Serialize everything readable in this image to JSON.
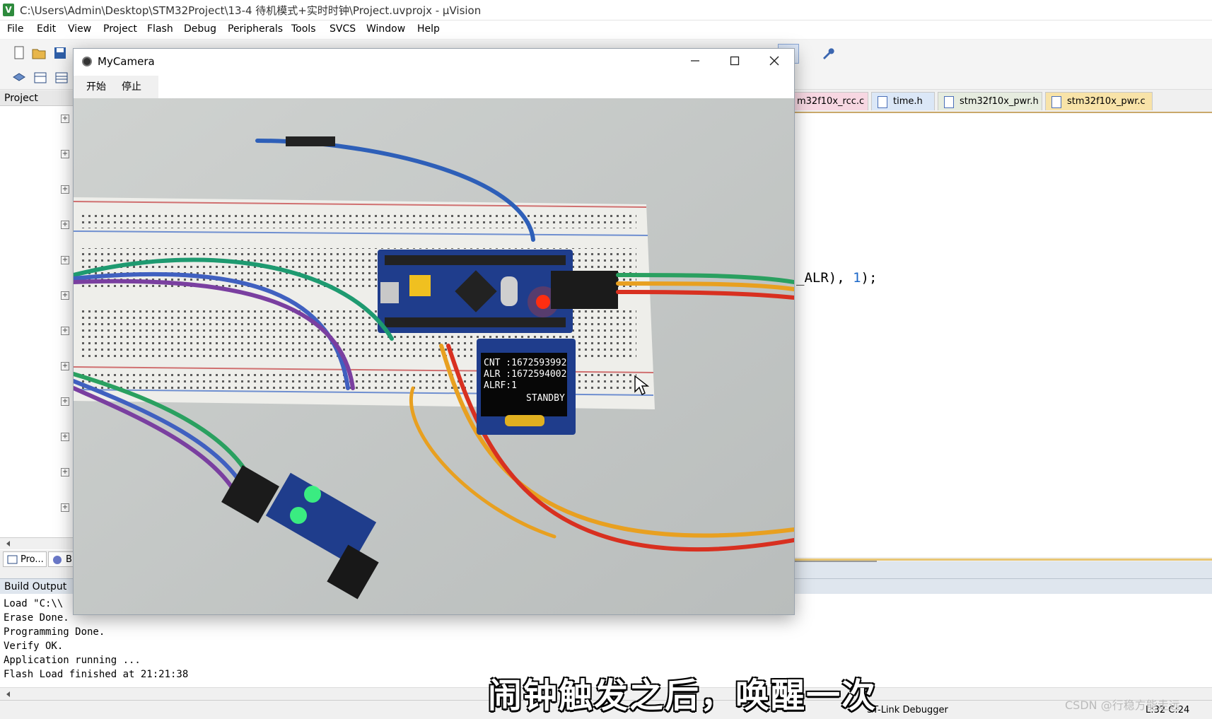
{
  "window": {
    "title": "C:\\Users\\Admin\\Desktop\\STM32Project\\13-4 待机模式+实时时钟\\Project.uvprojx - µVision",
    "app_icon": "uvision-icon"
  },
  "menu": [
    "File",
    "Edit",
    "View",
    "Project",
    "Flash",
    "Debug",
    "Peripherals",
    "Tools",
    "SVCS",
    "Window",
    "Help"
  ],
  "editor_tabs": [
    {
      "label": "m32f10x_rcc.c",
      "color": "#f7d7e2"
    },
    {
      "label": "time.h",
      "color": "#dbe7f7"
    },
    {
      "label": "stm32f10x_pwr.h",
      "color": "#e6ecdf"
    },
    {
      "label": "stm32f10x_pwr.c",
      "color": "#f8e3a8"
    }
  ],
  "code_visible": {
    "text": "_ALR), ",
    "num": "1",
    "tail": ");"
  },
  "project_panel": {
    "header": "Project",
    "tabs": [
      "Pro...",
      "B"
    ]
  },
  "build_output": {
    "header": "Build Output",
    "lines": [
      "Load \"C:\\\\",
      "Erase Done.",
      "Programming Done.",
      "Verify OK.",
      "Application running ...",
      "Flash Load finished at 21:21:38"
    ]
  },
  "status": {
    "debugger": "ST-Link Debugger",
    "position": "L:32 C:24"
  },
  "camera_window": {
    "title": "MyCamera",
    "start_label": "开始",
    "stop_label": "停止",
    "oled": {
      "cnt": "CNT :1672593992",
      "alr": "ALR :1672594002",
      "alrf": "ALRF:1",
      "mode": "STANDBY"
    }
  },
  "caption": "闹钟触发之后，唤醒一次",
  "watermark": "CSDN @行稳方能走远"
}
